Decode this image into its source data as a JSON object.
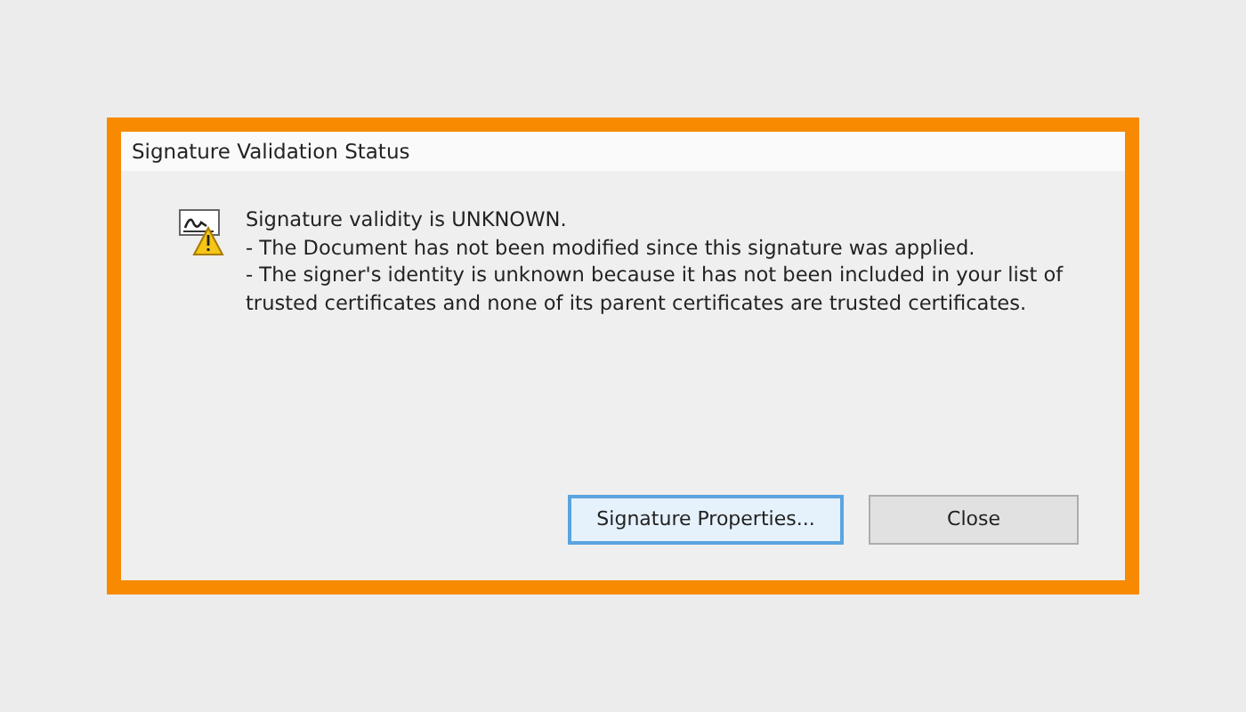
{
  "window": {
    "title": "Signature Validation Status"
  },
  "message": {
    "heading": "Signature validity is UNKNOWN.",
    "lines": [
      "- The Document has not been modified since this signature was applied.",
      "- The signer's identity is unknown because it has not been included in your list of trusted certificates and none of its parent certificates are trusted certificates."
    ]
  },
  "buttons": [
    {
      "label": "Signature Properties...",
      "focused": true
    },
    {
      "label": "Close",
      "focused": false
    }
  ]
}
